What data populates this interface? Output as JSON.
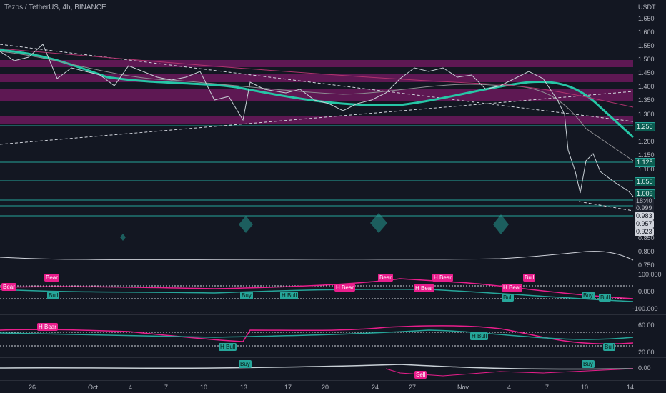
{
  "header": {
    "title": "Tezos / TetherUS, 4h, BINANCE",
    "currency": "USDT"
  },
  "price_axis": [
    "1.650",
    "1.600",
    "1.550",
    "1.500",
    "1.450",
    "1.400",
    "1.350",
    "1.300",
    "1.250",
    "1.200",
    "1.150",
    "1.100",
    "1.050",
    "1.000",
    "0.950",
    "0.900",
    "0.850",
    "0.800",
    "0.750"
  ],
  "price_tags": {
    "t1255": "1.255",
    "t1125": "1.125",
    "t1055": "1.055",
    "t1009": "1.009",
    "t1840": "18:40",
    "t0999": "0.999",
    "t0983": "0.983",
    "t0957": "0.957",
    "t0923": "0.923"
  },
  "osc1_axis": [
    "100.000",
    "0.000",
    "-100.000"
  ],
  "osc2_axis": [
    "60.00",
    "20.00"
  ],
  "osc3_axis": [
    "0.00"
  ],
  "time_axis": [
    "26",
    "Oct",
    "4",
    "7",
    "10",
    "13",
    "17",
    "20",
    "24",
    "27",
    "Nov",
    "4",
    "7",
    "10",
    "14"
  ],
  "signals": {
    "bull1": "Bull",
    "bull2": "Buy",
    "hbull1": "H Bull",
    "hbear1": "H Bear",
    "bear1": "Bear",
    "bear2": "Bear",
    "hbear2": "H Bear",
    "bull3": "Bull",
    "hbear3": "H Bear",
    "bull4": "Buy",
    "bear3": "Bear",
    "hbear4": "H Bear",
    "hbull2": "H Bull",
    "hbull3": "H Bull",
    "bull5": "Bull",
    "buy1": "Buy",
    "buy2": "Buy",
    "sell1": "Sell",
    "bull6": "Bull",
    "bull7": "Bull",
    "bull8": "Bull"
  },
  "colors": {
    "bg": "#131722",
    "teal": "#26a69a",
    "magenta": "#e91e8c",
    "bull": "#26a69a",
    "bear": "#e91e8c",
    "zone": "#9c1a7c"
  }
}
